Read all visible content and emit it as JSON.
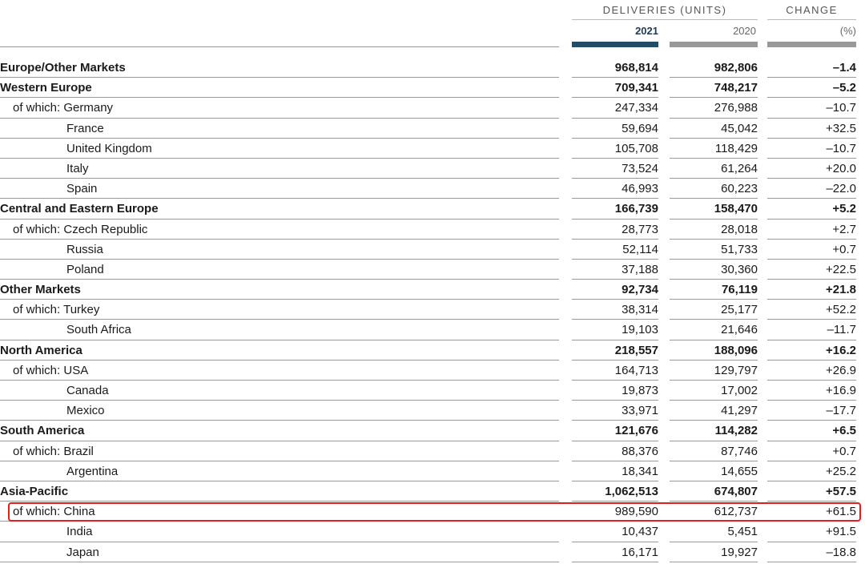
{
  "header": {
    "deliveries": "DELIVERIES (UNITS)",
    "change": "CHANGE",
    "y2021": "2021",
    "y2020": "2020",
    "pct": "(%)"
  },
  "rows": [
    {
      "label": "Europe/Other Markets",
      "v2021": "968,814",
      "v2020": "982,806",
      "change": "–1.4",
      "bold": true,
      "level": 0
    },
    {
      "label": "Western Europe",
      "v2021": "709,341",
      "v2020": "748,217",
      "change": "–5.2",
      "bold": true,
      "level": 0
    },
    {
      "label": "of which: Germany",
      "v2021": "247,334",
      "v2020": "276,988",
      "change": "–10.7",
      "bold": false,
      "level": 1
    },
    {
      "label": "France",
      "v2021": "59,694",
      "v2020": "45,042",
      "change": "+32.5",
      "bold": false,
      "level": 2
    },
    {
      "label": "United Kingdom",
      "v2021": "105,708",
      "v2020": "118,429",
      "change": "–10.7",
      "bold": false,
      "level": 2
    },
    {
      "label": "Italy",
      "v2021": "73,524",
      "v2020": "61,264",
      "change": "+20.0",
      "bold": false,
      "level": 2
    },
    {
      "label": "Spain",
      "v2021": "46,993",
      "v2020": "60,223",
      "change": "–22.0",
      "bold": false,
      "level": 2
    },
    {
      "label": "Central and Eastern Europe",
      "v2021": "166,739",
      "v2020": "158,470",
      "change": "+5.2",
      "bold": true,
      "level": 0
    },
    {
      "label": "of which: Czech Republic",
      "v2021": "28,773",
      "v2020": "28,018",
      "change": "+2.7",
      "bold": false,
      "level": 1
    },
    {
      "label": "Russia",
      "v2021": "52,114",
      "v2020": "51,733",
      "change": "+0.7",
      "bold": false,
      "level": 2
    },
    {
      "label": "Poland",
      "v2021": "37,188",
      "v2020": "30,360",
      "change": "+22.5",
      "bold": false,
      "level": 2
    },
    {
      "label": "Other Markets",
      "v2021": "92,734",
      "v2020": "76,119",
      "change": "+21.8",
      "bold": true,
      "level": 0
    },
    {
      "label": "of which: Turkey",
      "v2021": "38,314",
      "v2020": "25,177",
      "change": "+52.2",
      "bold": false,
      "level": 1
    },
    {
      "label": "South Africa",
      "v2021": "19,103",
      "v2020": "21,646",
      "change": "–11.7",
      "bold": false,
      "level": 2
    },
    {
      "label": "North America",
      "v2021": "218,557",
      "v2020": "188,096",
      "change": "+16.2",
      "bold": true,
      "level": 0
    },
    {
      "label": "of which: USA",
      "v2021": "164,713",
      "v2020": "129,797",
      "change": "+26.9",
      "bold": false,
      "level": 1
    },
    {
      "label": "Canada",
      "v2021": "19,873",
      "v2020": "17,002",
      "change": "+16.9",
      "bold": false,
      "level": 2
    },
    {
      "label": "Mexico",
      "v2021": "33,971",
      "v2020": "41,297",
      "change": "–17.7",
      "bold": false,
      "level": 2
    },
    {
      "label": "South America",
      "v2021": "121,676",
      "v2020": "114,282",
      "change": "+6.5",
      "bold": true,
      "level": 0
    },
    {
      "label": "of which: Brazil",
      "v2021": "88,376",
      "v2020": "87,746",
      "change": "+0.7",
      "bold": false,
      "level": 1
    },
    {
      "label": "Argentina",
      "v2021": "18,341",
      "v2020": "14,655",
      "change": "+25.2",
      "bold": false,
      "level": 2
    },
    {
      "label": "Asia-Pacific",
      "v2021": "1,062,513",
      "v2020": "674,807",
      "change": "+57.5",
      "bold": true,
      "level": 0
    },
    {
      "label": "of which: China",
      "v2021": "989,590",
      "v2020": "612,737",
      "change": "+61.5",
      "bold": false,
      "level": 1
    },
    {
      "label": "India",
      "v2021": "10,437",
      "v2020": "5,451",
      "change": "+91.5",
      "bold": false,
      "level": 2
    },
    {
      "label": "Japan",
      "v2021": "16,171",
      "v2020": "19,927",
      "change": "–18.8",
      "bold": false,
      "level": 2
    }
  ],
  "highlight_color": "#e02020",
  "accent_color": "#1f4e6b"
}
